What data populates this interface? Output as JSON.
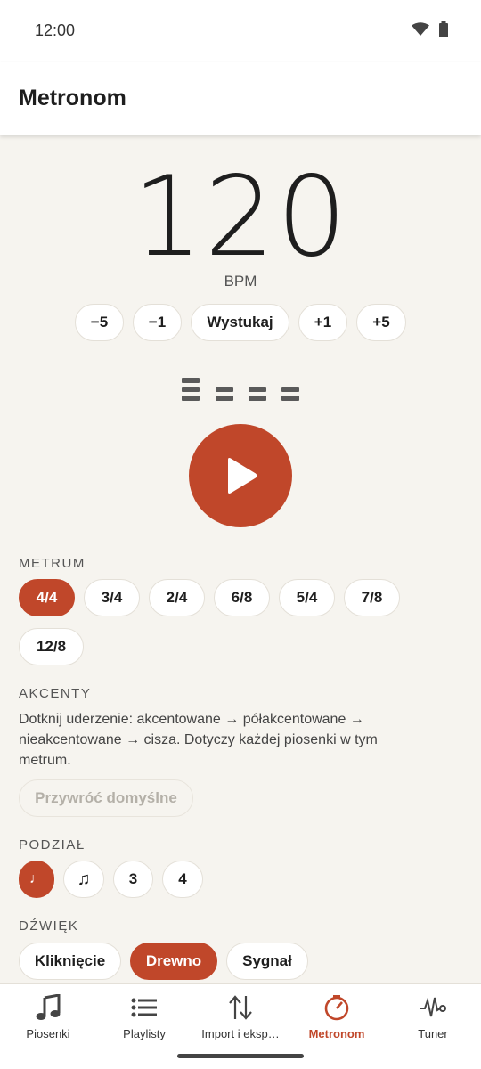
{
  "status_bar": {
    "time": "12:00"
  },
  "app_bar": {
    "title": "Metronom"
  },
  "tempo": {
    "bpm": "120",
    "unit": "BPM",
    "controls": [
      {
        "label": "−5"
      },
      {
        "label": "−1"
      },
      {
        "label": "Wystukaj"
      },
      {
        "label": "+1"
      },
      {
        "label": "+5"
      }
    ]
  },
  "beat_indicator": {
    "levels": [
      "accent",
      "normal",
      "normal",
      "normal"
    ]
  },
  "play_button": {
    "icon": "play-icon"
  },
  "meter": {
    "label": "METRUM",
    "options": [
      "4/4",
      "3/4",
      "2/4",
      "6/8",
      "5/4",
      "7/8",
      "12/8"
    ],
    "selected": "4/4"
  },
  "accents": {
    "label": "AKCENTY",
    "description": "Dotknij uderzenie: akcentowane → półakcentowane → nieakcentowane → cisza. Dotyczy każdej piosenki w tym metrum.",
    "reset_label": "Przywróć domyślne"
  },
  "subdivision": {
    "label": "PODZIAŁ",
    "options": [
      "♩",
      "♫",
      "3",
      "4"
    ],
    "selected": "♩"
  },
  "sound": {
    "label": "DŹWIĘK",
    "options": [
      "Kliknięcie",
      "Drewno",
      "Sygnał"
    ],
    "selected": "Drewno"
  },
  "nav": {
    "items": [
      {
        "label": "Piosenki",
        "icon": "music-note-icon"
      },
      {
        "label": "Playlisty",
        "icon": "list-icon"
      },
      {
        "label": "Import i eksp…",
        "icon": "import-export-icon"
      },
      {
        "label": "Metronom",
        "icon": "metronome-icon",
        "active": true
      },
      {
        "label": "Tuner",
        "icon": "waveform-icon"
      }
    ]
  },
  "colors": {
    "accent": "#c0472a",
    "background": "#f6f4ef",
    "surface": "#ffffff"
  }
}
